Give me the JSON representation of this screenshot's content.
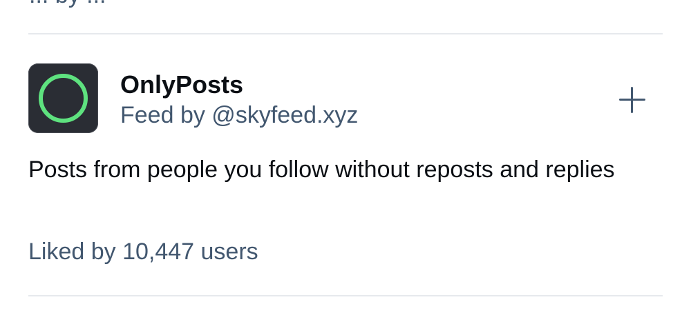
{
  "previous_item": {
    "clipped_text": "... by ..."
  },
  "feed": {
    "name": "OnlyPosts",
    "author_line": "Feed by @skyfeed.xyz",
    "description": "Posts from people you follow without reposts and replies",
    "likes_text": "Liked by 10,447 users",
    "add_button_glyph": "+"
  },
  "colors": {
    "background": "#ffffff",
    "divider": "#e6e9ed",
    "primary_text": "#0b0f14",
    "secondary_text": "#42576f",
    "avatar_bg": "#2a2d34",
    "avatar_ring": "#5ee27f"
  },
  "icons": {
    "avatar": "green-ring-logo",
    "add": "plus-icon"
  }
}
